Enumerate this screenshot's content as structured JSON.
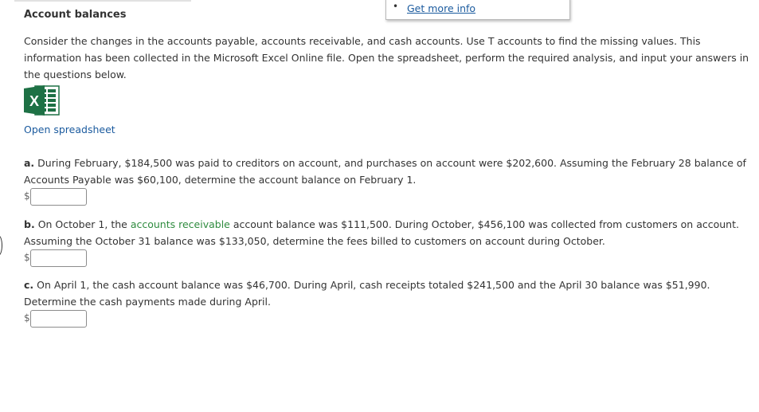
{
  "info_popup": {
    "link_label": "Get more info"
  },
  "page": {
    "heading": "Account balances",
    "intro": "Consider the changes in the accounts payable, accounts receivable, and cash accounts. Use T accounts to find the missing values. This information has been collected in the Microsoft Excel Online file. Open the spreadsheet, perform the required analysis, and input your answers in the questions below."
  },
  "spreadsheet": {
    "icon": "excel-icon",
    "icon_letter": "X",
    "brand_color": "#1e7145",
    "link_label": "Open spreadsheet"
  },
  "questions": [
    {
      "letter": "a.",
      "text": "During February, $184,500 was paid to creditors on account, and purchases on account were $202,600. Assuming the February 28 balance of Accounts Payable was $60,100, determine the account balance on February 1.",
      "currency": "$",
      "answer": ""
    },
    {
      "letter": "b.",
      "text_before": "On October 1, the",
      "term_link": "accounts receivable",
      "text_after": "account balance was $111,500. During October, $456,100 was collected from customers on account. Assuming the October 31 balance was $133,050, determine the fees billed to customers on account during October.",
      "currency": "$",
      "answer": ""
    },
    {
      "letter": "c.",
      "text": "On April 1, the cash account balance was $46,700. During April, cash receipts totaled $241,500 and the April 30 balance was $51,990. Determine the cash payments made during April.",
      "currency": "$",
      "answer": ""
    }
  ]
}
